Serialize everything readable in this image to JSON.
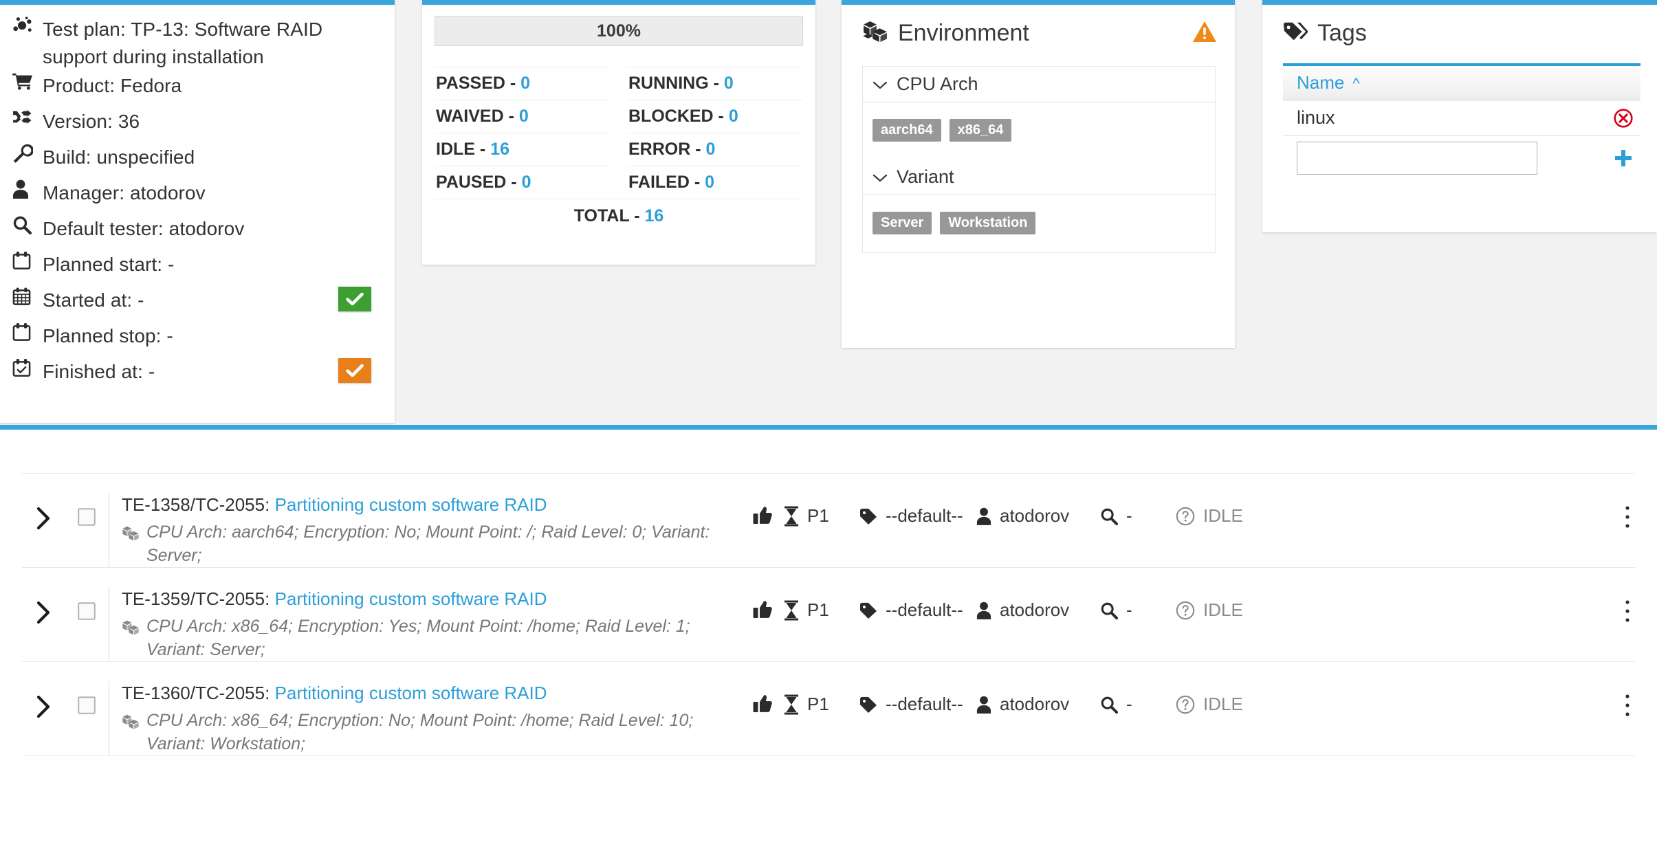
{
  "plan": {
    "rows": [
      {
        "icon": "sitemap-icon",
        "label": "Test plan: TP-13: Software RAID support during installation",
        "button": null
      },
      {
        "icon": "cart-icon",
        "label": "Product: Fedora",
        "button": null
      },
      {
        "icon": "shuffle-icon",
        "label": "Version: 36",
        "button": null
      },
      {
        "icon": "wrench-icon",
        "label": "Build: unspecified",
        "button": null
      },
      {
        "icon": "user-icon",
        "label": "Manager: atodorov",
        "button": null
      },
      {
        "icon": "search-icon",
        "label": "Default tester: atodorov",
        "button": null
      },
      {
        "icon": "calendar-icon",
        "label": "Planned start: -",
        "button": null
      },
      {
        "icon": "calendar-grid-icon",
        "label": "Started at: -",
        "button": "green"
      },
      {
        "icon": "calendar-icon",
        "label": "Planned stop: -",
        "button": null
      },
      {
        "icon": "calendar-check-icon",
        "label": "Finished at: -",
        "button": "orange"
      }
    ]
  },
  "stats": {
    "progress_label": "100%",
    "cells": [
      {
        "label": "PASSED",
        "value": "0"
      },
      {
        "label": "RUNNING",
        "value": "0"
      },
      {
        "label": "WAIVED",
        "value": "0"
      },
      {
        "label": "BLOCKED",
        "value": "0"
      },
      {
        "label": "IDLE",
        "value": "16"
      },
      {
        "label": "ERROR",
        "value": "0"
      },
      {
        "label": "PAUSED",
        "value": "0"
      },
      {
        "label": "FAILED",
        "value": "0"
      }
    ],
    "total_label": "TOTAL",
    "total_value": "16"
  },
  "environment": {
    "title": "Environment",
    "groups": [
      {
        "name": "CPU Arch",
        "values": [
          "aarch64",
          "x86_64"
        ]
      },
      {
        "name": "Variant",
        "values": [
          "Server",
          "Workstation"
        ]
      }
    ]
  },
  "tags": {
    "title": "Tags",
    "column_header": "Name",
    "sort_caret": "^",
    "rows": [
      {
        "name": "linux"
      }
    ],
    "new_tag_value": "",
    "new_tag_placeholder": ""
  },
  "executions": {
    "rows": [
      {
        "id": "TE-1358/TC-2055:",
        "link": "Partitioning custom software RAID",
        "properties": "CPU Arch: aarch64; Encryption: No; Mount Point: /; Raid Level: 0; Variant: Server;",
        "priority": "P1",
        "tag": "--default--",
        "assignee": "atodorov",
        "finding": "-",
        "status": "IDLE"
      },
      {
        "id": "TE-1359/TC-2055:",
        "link": "Partitioning custom software RAID",
        "properties": "CPU Arch: x86_64; Encryption: Yes; Mount Point: /home; Raid Level: 1; Variant: Server;",
        "priority": "P1",
        "tag": "--default--",
        "assignee": "atodorov",
        "finding": "-",
        "status": "IDLE"
      },
      {
        "id": "TE-1360/TC-2055:",
        "link": "Partitioning custom software RAID",
        "properties": "CPU Arch: x86_64; Encryption: No; Mount Point: /home; Raid Level: 10; Variant: Workstation;",
        "priority": "P1",
        "tag": "--default--",
        "assignee": "atodorov",
        "finding": "-",
        "status": "IDLE"
      }
    ]
  },
  "colors": {
    "accent": "#39a5dc",
    "link": "#2c9fd9",
    "success": "#3c9f32",
    "warning": "#e8801a",
    "danger": "#d9001b",
    "pill": "#989898"
  }
}
